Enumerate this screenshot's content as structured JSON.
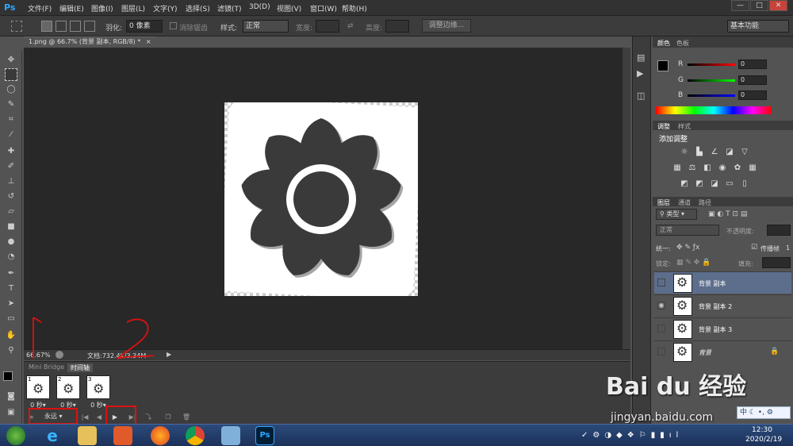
{
  "app": {
    "logo": "Ps",
    "menu": [
      "文件(F)",
      "编辑(E)",
      "图像(I)",
      "图层(L)",
      "文字(Y)",
      "选择(S)",
      "滤镜(T)",
      "3D(D)",
      "视图(V)",
      "窗口(W)",
      "帮助(H)"
    ],
    "min": "—",
    "max": "□",
    "close": "✕"
  },
  "options": {
    "feather_label": "羽化:",
    "feather_value": "0 像素",
    "antialias_label": "消除锯齿",
    "style_label": "样式:",
    "style_value": "正常",
    "width_label": "宽度:",
    "height_label": "高度:",
    "refine_edge": "调整边缘...",
    "workspace": "基本功能"
  },
  "document": {
    "tab_title": "1.png @ 66.7% (背景 副本, RGB/8) *",
    "close": "×",
    "zoom": "66.67%",
    "doc_info": "文档:732.4K/3.34M"
  },
  "timeline": {
    "tabs": [
      "Mini Bridge",
      "时间轴"
    ],
    "frames": [
      {
        "num": "1",
        "time": "0 秒▾"
      },
      {
        "num": "2",
        "time": "0 秒▾"
      },
      {
        "num": "3",
        "time": "0 秒▾"
      }
    ],
    "loop": "永远"
  },
  "color_panel": {
    "tabs": [
      "颜色",
      "色板"
    ],
    "r_label": "R",
    "g_label": "G",
    "b_label": "B",
    "r": "0",
    "g": "0",
    "b": "0"
  },
  "adjust_panel": {
    "tabs": [
      "调整",
      "样式"
    ],
    "title": "添加调整"
  },
  "layers_panel": {
    "tabs": [
      "图层",
      "通道",
      "路径"
    ],
    "filter": "类型",
    "blend": "正常",
    "opacity_label": "不透明度:",
    "unify_label": "统一:",
    "propagate_label": "传播帧",
    "propagate_value": "1",
    "lock_label": "锁定:",
    "fill_label": "填充:",
    "layers": [
      {
        "name": "背景 副本",
        "visible": false,
        "selected": true,
        "locked": false
      },
      {
        "name": "背景 副本 2",
        "visible": true,
        "selected": false,
        "locked": false
      },
      {
        "name": "背景 副本 3",
        "visible": false,
        "selected": false,
        "locked": false
      },
      {
        "name": "背景",
        "visible": false,
        "selected": false,
        "locked": true
      }
    ]
  },
  "annotations": {
    "one": "1",
    "two": "2"
  },
  "watermark": {
    "brand": "Bai du 经验",
    "url": "jingyan.baidu.com",
    "ime": "中"
  },
  "taskbar": {
    "time": "12:30",
    "date": "2020/2/19",
    "ps_label": "Ps"
  },
  "colors": {
    "accent": "#31a8ff",
    "annotation": "#e01010",
    "selected_layer": "#5c6e8c"
  }
}
